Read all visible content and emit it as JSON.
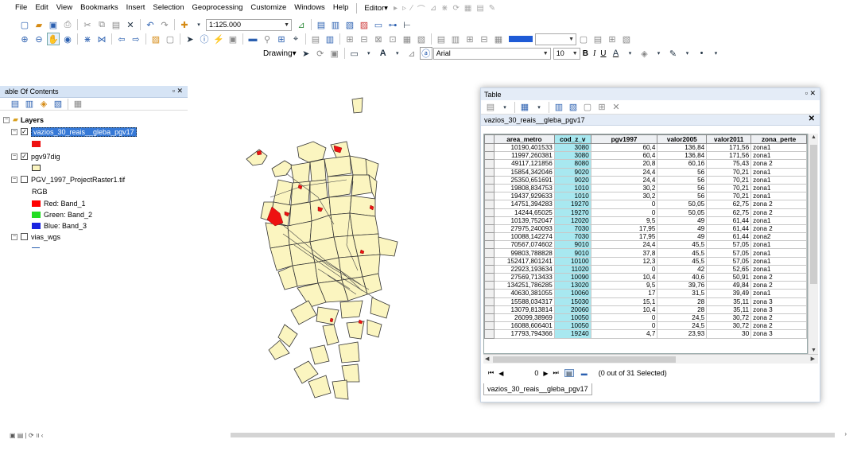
{
  "menu": [
    "File",
    "Edit",
    "View",
    "Bookmarks",
    "Insert",
    "Selection",
    "Geoprocessing",
    "Customize",
    "Windows",
    "Help"
  ],
  "editor_label": "Editor▾",
  "scale_value": "1:125.000",
  "drawing_label": "Drawing▾",
  "font_name": "Arial",
  "font_size": "10",
  "fmt_bold": "B",
  "fmt_italic": "I",
  "fmt_underline": "U",
  "toc": {
    "title": "able Of Contents",
    "layers_label": "Layers",
    "items": [
      {
        "label": "vazios_30_reais__gleba_pgv17",
        "checked": true,
        "selected": true
      },
      {
        "label": "pgv97dig",
        "checked": true
      },
      {
        "label": "PGV_1997_ProjectRaster1.tif",
        "checked": false
      },
      {
        "label": "RGB"
      },
      {
        "label": "Red:  Band_1",
        "color": "#ff0000"
      },
      {
        "label": "Green: Band_2",
        "color": "#22dd22"
      },
      {
        "label": "Blue:  Band_3",
        "color": "#1a24e0"
      },
      {
        "label": "vias_wgs",
        "checked": false
      }
    ]
  },
  "table": {
    "window_title": "Table",
    "layer_name": "vazios_30_reais__gleba_pgv17",
    "columns": [
      "area_metro",
      "cod_z_v",
      "pgv1997",
      "valor2005",
      "valor2011",
      "zona_perte"
    ],
    "rows": [
      [
        "10190,401533",
        "3080",
        "60,4",
        "136,84",
        "171,56",
        "zona1"
      ],
      [
        "11997,260381",
        "3080",
        "60,4",
        "136,84",
        "171,56",
        "zona1"
      ],
      [
        "49117,121856",
        "8080",
        "20,8",
        "60,16",
        "75,43",
        "zona 2"
      ],
      [
        "15854,342046",
        "9020",
        "24,4",
        "56",
        "70,21",
        "zona1"
      ],
      [
        "25350,651691",
        "9020",
        "24,4",
        "56",
        "70,21",
        "zona1"
      ],
      [
        "19808,834753",
        "1010",
        "30,2",
        "56",
        "70,21",
        "zona1"
      ],
      [
        "19437,929633",
        "1010",
        "30,2",
        "56",
        "70,21",
        "zona1"
      ],
      [
        "14751,394283",
        "19270",
        "0",
        "50,05",
        "62,75",
        "zona 2"
      ],
      [
        "14244,65025",
        "19270",
        "0",
        "50,05",
        "62,75",
        "zona 2"
      ],
      [
        "10139,752047",
        "12020",
        "9,5",
        "49",
        "61,44",
        "zona1"
      ],
      [
        "27975,240093",
        "7030",
        "17,95",
        "49",
        "61,44",
        "zona 2"
      ],
      [
        "10088,142274",
        "7030",
        "17,95",
        "49",
        "61,44",
        "zona2"
      ],
      [
        "70567,074602",
        "9010",
        "24,4",
        "45,5",
        "57,05",
        "zona1"
      ],
      [
        "99803,788828",
        "9010",
        "37,8",
        "45,5",
        "57,05",
        "zona1"
      ],
      [
        "152417,801241",
        "10100",
        "12,3",
        "45,5",
        "57,05",
        "zona1"
      ],
      [
        "22923,193634",
        "11020",
        "0",
        "42",
        "52,65",
        "zona1"
      ],
      [
        "27569,713433",
        "10090",
        "10,4",
        "40,6",
        "50,91",
        "zona 2"
      ],
      [
        "134251,786285",
        "13020",
        "9,5",
        "39,76",
        "49,84",
        "zona 2"
      ],
      [
        "40630,381055",
        "10060",
        "17",
        "31,5",
        "39,49",
        "zona1"
      ],
      [
        "15588,034317",
        "15030",
        "15,1",
        "28",
        "35,11",
        "zona 3"
      ],
      [
        "13079,813814",
        "20060",
        "10,4",
        "28",
        "35,11",
        "zona 3"
      ],
      [
        "26099,38969",
        "10050",
        "0",
        "24,5",
        "30,72",
        "zona 2"
      ],
      [
        "16088,606401",
        "10050",
        "0",
        "24,5",
        "30,72",
        "zona 2"
      ],
      [
        "17793,794366",
        "19240",
        "4,7",
        "23,93",
        "30",
        "zona 3"
      ]
    ],
    "record_index": "0",
    "selection_status": "(0 out of 31 Selected)",
    "tab_label": "vazios_30_reais__gleba_pgv17"
  },
  "colors": {
    "parcel_fill": "#fbf5c0",
    "parcel_stroke": "#333333",
    "selected_parcel": "#ee1111",
    "selected_column": "#a8e8f0",
    "toc_header": "#d6e4f5"
  }
}
